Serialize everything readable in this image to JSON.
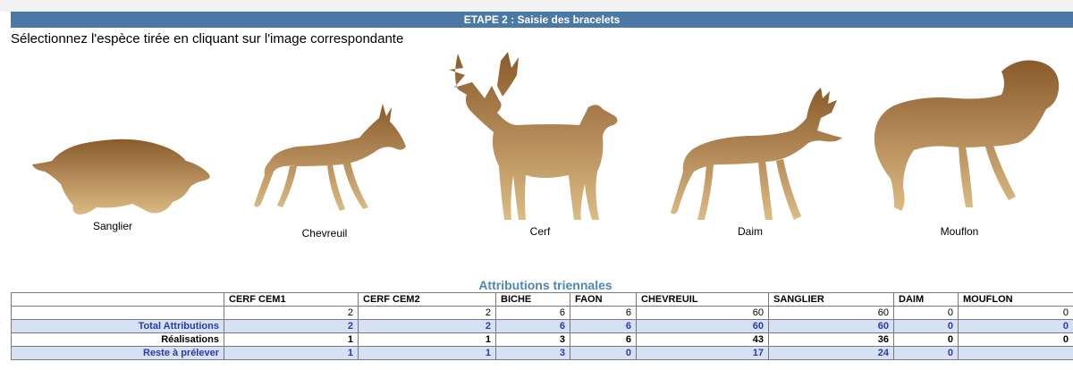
{
  "header": {
    "title": "ETAPE 2 : Saisie des bracelets"
  },
  "instruction": "Sélectionnez l'espèce tirée en cliquant sur l'image correspondante",
  "species": [
    {
      "label": "Sanglier",
      "icon": "boar-silhouette-icon"
    },
    {
      "label": "Chevreuil",
      "icon": "roe-deer-silhouette-icon"
    },
    {
      "label": "Cerf",
      "icon": "red-deer-silhouette-icon"
    },
    {
      "label": "Daim",
      "icon": "fallow-deer-silhouette-icon"
    },
    {
      "label": "Mouflon",
      "icon": "mouflon-silhouette-icon"
    }
  ],
  "colors": {
    "header_bg": "#4a79a8",
    "title_blue": "#4d86b9",
    "row_blue_bg": "#d6e1f3",
    "row_blue_text": "#2a3ca8",
    "silhouette_dark": "#8a5a2b",
    "silhouette_light": "#dcbb84"
  },
  "table": {
    "title": "Attributions triennales",
    "columns": [
      "",
      "CERF CEM1",
      "CERF CEM2",
      "BICHE",
      "FAON",
      "CHEVREUIL",
      "SANGLIER",
      "DAIM",
      "MOUFLON"
    ],
    "rows": [
      {
        "label": "",
        "values": [
          "2",
          "2",
          "6",
          "6",
          "60",
          "60",
          "0",
          "0"
        ]
      },
      {
        "label": "Total Attributions",
        "values": [
          "2",
          "2",
          "6",
          "6",
          "60",
          "60",
          "0",
          "0"
        ]
      },
      {
        "label": "Réalisations",
        "values": [
          "1",
          "1",
          "3",
          "6",
          "43",
          "36",
          "0",
          "0"
        ]
      },
      {
        "label": "Reste à prélever",
        "values": [
          "1",
          "1",
          "3",
          "0",
          "17",
          "24",
          "0",
          ""
        ]
      }
    ]
  }
}
